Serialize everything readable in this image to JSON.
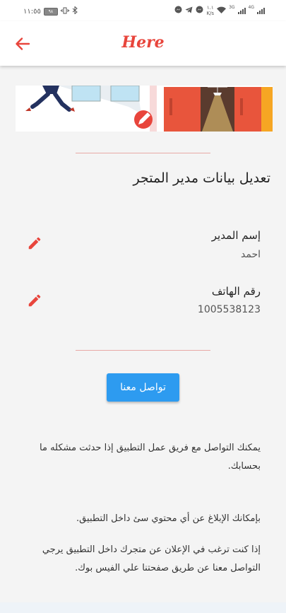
{
  "status_bar": {
    "time": "١١:٥٥",
    "battery": "٩٨",
    "speed_value": "١.١",
    "speed_unit": "K/s",
    "net_4g": "4G",
    "net_3g": "3G",
    "icons": [
      "battery-icon",
      "vibrate-icon",
      "bluetooth-icon",
      "messenger-icon",
      "telegram-icon",
      "messenger-icon",
      "wifi-icon",
      "signal-icon"
    ]
  },
  "app_bar": {
    "title": "Here",
    "back_icon": "arrow-back-icon"
  },
  "colors": {
    "accent": "#e8453c",
    "button": "#2d9bf0",
    "divider": "#e8a9a6",
    "background": "#f4f4f4"
  },
  "section": {
    "title": "تعديل بيانات مدير المتجر"
  },
  "fields": [
    {
      "label": "إسم المدير",
      "value": "احمد",
      "edit_icon": "pencil-icon"
    },
    {
      "label": "رقم الهاتف",
      "value": "1005538123",
      "edit_icon": "pencil-icon"
    }
  ],
  "contact_button": "تواصل معنا",
  "info": {
    "p1": "يمكنك التواصل مع فريق عمل التطبيق إذا حدثت مشكله ما بحسابك.",
    "p2": "بإمكانك الإبلاغ عن أي محتوي سئ  داخل التطبيق.",
    "p3": "إذا كنت ترغب في الإعلان عن متجرك داخل التطبيق يرجي التواصل معنا عن طريق صفحتنا علي الفيس بوك."
  }
}
